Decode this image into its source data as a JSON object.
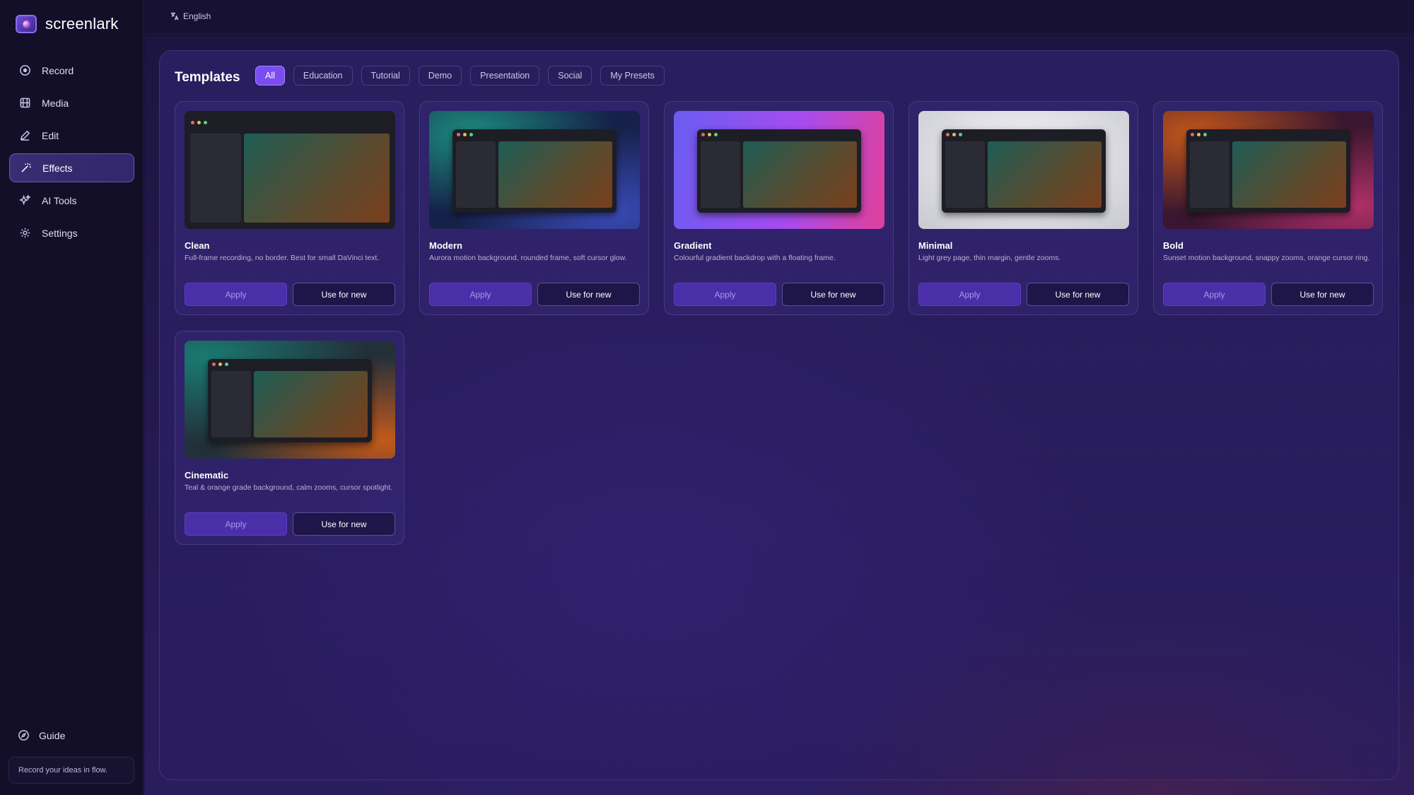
{
  "app": {
    "name": "screenlark"
  },
  "sidebar": {
    "items": [
      {
        "label": "Record",
        "icon": "record-icon"
      },
      {
        "label": "Media",
        "icon": "film-icon"
      },
      {
        "label": "Edit",
        "icon": "pencil-icon"
      },
      {
        "label": "Effects",
        "icon": "magic-wand-icon",
        "active": true
      },
      {
        "label": "AI Tools",
        "icon": "sparkles-icon"
      },
      {
        "label": "Settings",
        "icon": "gear-icon"
      }
    ],
    "guide_label": "Guide",
    "tagline": "Record your ideas in flow."
  },
  "topbar": {
    "language": "English"
  },
  "templates": {
    "title": "Templates",
    "tabs": [
      "All",
      "Education",
      "Tutorial",
      "Demo",
      "Presentation",
      "Social",
      "My Presets"
    ],
    "active_tab": "All",
    "apply_label": "Apply",
    "use_label": "Use for new",
    "cards": [
      {
        "title": "Clean",
        "desc": "Full-frame recording, no border. Best for small DaVinci text."
      },
      {
        "title": "Modern",
        "desc": "Aurora motion background, rounded frame, soft cursor glow."
      },
      {
        "title": "Gradient",
        "desc": "Colourful gradient backdrop with a floating frame."
      },
      {
        "title": "Minimal",
        "desc": "Light grey page, thin margin, gentle zooms."
      },
      {
        "title": "Bold",
        "desc": "Sunset motion background, snappy zooms, orange cursor ring."
      },
      {
        "title": "Cinematic",
        "desc": "Teal & orange grade background, calm zooms, cursor spotlight."
      }
    ]
  },
  "colors": {
    "accent": "#7a4df0",
    "sidebar_bg": "#130f29",
    "panel_border": "#3e3378"
  }
}
